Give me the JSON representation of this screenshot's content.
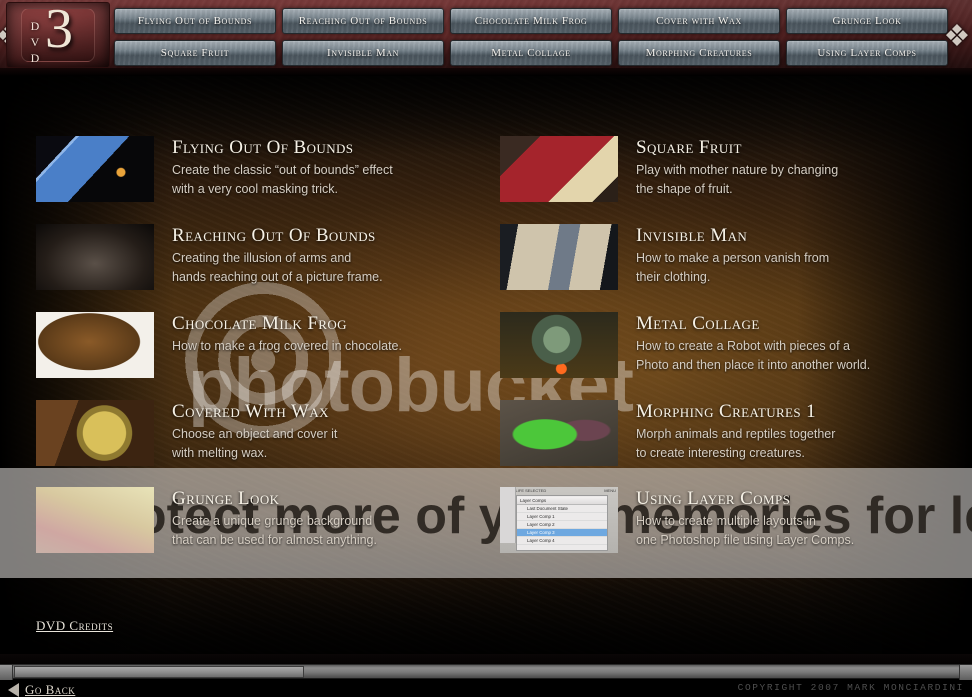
{
  "header": {
    "dvd_word": "DVD",
    "dvd_number": "3",
    "nav_buttons_row1": [
      "Flying Out of Bounds",
      "Reaching Out of Bounds",
      "Chocolate Milk Frog",
      "Cover with Wax",
      "Grunge Look"
    ],
    "nav_buttons_row2": [
      "Square Fruit",
      "Invisible Man",
      "Metal Collage",
      "Morphing Creatures",
      "Using Layer Comps"
    ]
  },
  "watermark": {
    "brand": "photobucket",
    "ad_text": "Protect more of your memories for less!"
  },
  "left_column": [
    {
      "title": "Flying Out Of Bounds",
      "desc_line1": "Create the classic “out of bounds” effect",
      "desc_line2": "with a very cool masking trick.",
      "thumb": "snowboarder-photo"
    },
    {
      "title": "Reaching Out Of Bounds",
      "desc_line1": "Creating the illusion of arms and",
      "desc_line2": "hands reaching out of a picture frame.",
      "thumb": "hands-picture-frame-photo"
    },
    {
      "title": "Chocolate Milk Frog",
      "desc_line1": "How to make a frog covered in chocolate.",
      "desc_line2": "",
      "thumb": "chocolate-frog-photo"
    },
    {
      "title": "Covered With Wax",
      "desc_line1": "Choose an object and cover it",
      "desc_line2": "with melting wax.",
      "thumb": "wax-covered-object-photo"
    },
    {
      "title": "Grunge Look",
      "desc_line1": "Create a unique grunge background",
      "desc_line2": "that can be used for almost anything.",
      "thumb": "grunge-background-photo"
    }
  ],
  "right_column": [
    {
      "title": "Square Fruit",
      "desc_line1": "Play with mother nature by changing",
      "desc_line2": "the shape of fruit.",
      "thumb": "square-apple-photo"
    },
    {
      "title": "Invisible Man",
      "desc_line1": "How to make a person vanish from",
      "desc_line2": "their clothing.",
      "thumb": "invisible-man-photo"
    },
    {
      "title": "Metal Collage",
      "desc_line1": "How to create a Robot with pieces of a",
      "desc_line2": "Photo and then place it into another world.",
      "thumb": "robot-collage-photo"
    },
    {
      "title": "Morphing Creatures 1",
      "desc_line1": "Morph animals and reptiles together",
      "desc_line2": "to create interesting creatures.",
      "thumb": "green-lizard-photo"
    },
    {
      "title": "Using Layer Comps",
      "desc_line1": "How to create multiple layouts in",
      "desc_line2": "one Photoshop file using Layer Comps.",
      "thumb": "layer-comps-panel-screenshot"
    }
  ],
  "layer_comps_panel": {
    "title": "Layer Comps",
    "top_left": "MOOD LIFE SELECTED",
    "top_right": "MENU",
    "rows": [
      "Last Document State",
      "Layer Comp 1",
      "Layer Comp 2",
      "Layer Comp 3",
      "Layer Comp 4"
    ],
    "selected_index": 3
  },
  "footer": {
    "credits_label": "DVD Credits",
    "go_back_label": "Go Back",
    "copyright": "COPYRIGHT 2007 MARK MONCIARDINI"
  },
  "colors": {
    "header_red": "#6d2a2a",
    "button_steel": "#5e6c76",
    "stage_amber": "#4a3011",
    "title_cream": "#f6f1e6",
    "desc_grey": "#d6cec3",
    "selected_blue": "#6ea8e0"
  }
}
